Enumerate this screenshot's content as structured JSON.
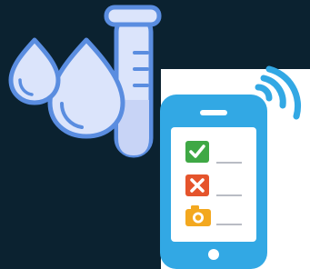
{
  "scene": {
    "background_color": "#0b2230",
    "panel_color": "#ffffff",
    "lab_icon": {
      "name": "water-drops-and-test-tube",
      "fill_light": "#dbe4fb",
      "fill_mid": "#c8d4f6",
      "stroke": "#5a8de0"
    },
    "phone_icon": {
      "name": "smartphone-checklist",
      "body_color": "#32a8e4",
      "screen_color": "#ffffff",
      "signal_color": "#32a8e4"
    },
    "checklist": [
      {
        "icon": "check-icon",
        "color": "#3fa845"
      },
      {
        "icon": "cross-icon",
        "color": "#e5542c"
      },
      {
        "icon": "camera-icon",
        "color": "#f3a81f"
      }
    ]
  }
}
